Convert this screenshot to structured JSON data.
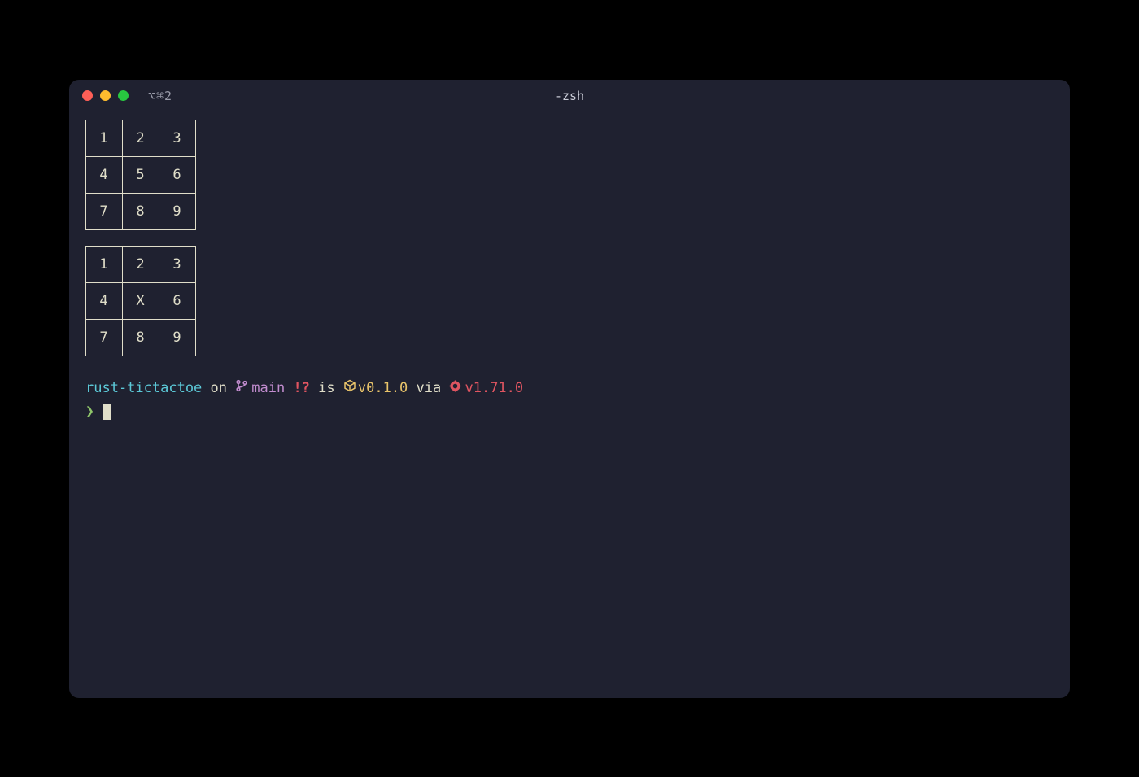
{
  "titlebar": {
    "shortcut": "⌥⌘2",
    "title": "-zsh"
  },
  "boards": [
    {
      "rows": [
        [
          "1",
          "2",
          "3"
        ],
        [
          "4",
          "5",
          "6"
        ],
        [
          "7",
          "8",
          "9"
        ]
      ]
    },
    {
      "rows": [
        [
          "1",
          "2",
          "3"
        ],
        [
          "4",
          "X",
          "6"
        ],
        [
          "7",
          "8",
          "9"
        ]
      ]
    }
  ],
  "prompt": {
    "directory": "rust-tictactoe",
    "on_text": " on ",
    "branch": "main",
    "git_status": " !?",
    "is_text": " is ",
    "package_version": "v0.1.0",
    "via_text": " via ",
    "rust_version": "v1.71.0",
    "arrow": "❯"
  }
}
